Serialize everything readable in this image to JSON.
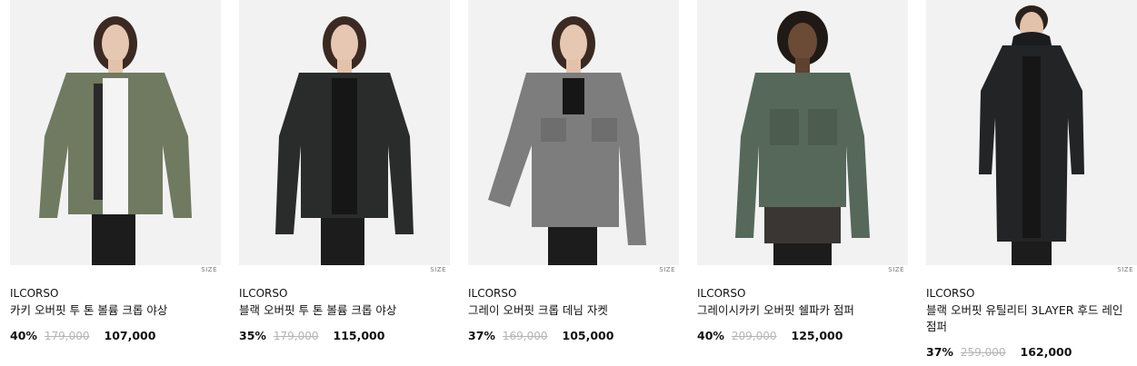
{
  "products": [
    {
      "brand": "ILCORSO",
      "name": "카키 오버핏 투 톤 볼륨 크롭 야상",
      "discount": "40%",
      "original_price": "179,000",
      "price": "107,000",
      "size_label": "SIZE",
      "jacket_color": "#707a60",
      "inner_color": "#f4f4f4",
      "pants_color": "#1c1c1c"
    },
    {
      "brand": "ILCORSO",
      "name": "블랙 오버핏 투 톤 볼륨 크롭 야상",
      "discount": "35%",
      "original_price": "179,000",
      "price": "115,000",
      "size_label": "SIZE",
      "jacket_color": "#2a2c2b",
      "inner_color": "#161616",
      "pants_color": "#1c1c1c"
    },
    {
      "brand": "ILCORSO",
      "name": "그레이 오버핏 크롭 데님 자켓",
      "discount": "37%",
      "original_price": "169,000",
      "price": "105,000",
      "size_label": "SIZE",
      "jacket_color": "#7d7d7d",
      "inner_color": "#161616",
      "pants_color": "#1c1c1c"
    },
    {
      "brand": "ILCORSO",
      "name": "그레이시카키 오버핏 쉘파카 점퍼",
      "discount": "40%",
      "original_price": "209,000",
      "price": "125,000",
      "size_label": "SIZE",
      "jacket_color": "#56685a",
      "inner_color": "#3a3634",
      "pants_color": "#1c1c1c"
    },
    {
      "brand": "ILCORSO",
      "name": "블랙 오버핏 유틸리티 3LAYER 후드 레인 점퍼",
      "discount": "37%",
      "original_price": "259,000",
      "price": "162,000",
      "size_label": "SIZE",
      "jacket_color": "#222426",
      "inner_color": "#161616",
      "pants_color": "#1c1c1c"
    }
  ]
}
